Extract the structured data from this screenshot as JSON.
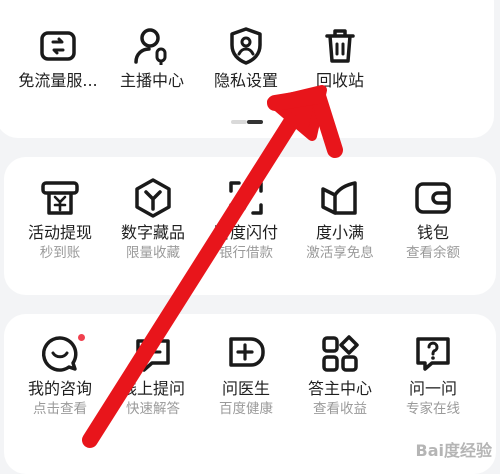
{
  "row1": [
    {
      "label": "免流量服...",
      "icon": "phone-data-icon"
    },
    {
      "label": "主播中心",
      "icon": "anchor-mic-icon"
    },
    {
      "label": "隐私设置",
      "icon": "privacy-shield-icon"
    },
    {
      "label": "回收站",
      "icon": "trash-icon"
    }
  ],
  "row2": [
    {
      "label": "活动提现",
      "sub": "秒到账",
      "icon": "withdraw-icon"
    },
    {
      "label": "数字藏品",
      "sub": "限量收藏",
      "icon": "digital-collection-icon"
    },
    {
      "label": "百度闪付",
      "sub": "银行借款",
      "icon": "flash-pay-icon"
    },
    {
      "label": "度小满",
      "sub": "激活享免息",
      "icon": "duxiaoman-icon"
    },
    {
      "label": "钱包",
      "sub": "查看余额",
      "icon": "wallet-icon"
    }
  ],
  "row3": [
    {
      "label": "我的咨询",
      "sub": "点击查看",
      "icon": "consult-chat-icon",
      "badge": true
    },
    {
      "label": "线上提问",
      "sub": "快速解答",
      "icon": "ask-question-icon"
    },
    {
      "label": "问医生",
      "sub": "百度健康",
      "icon": "doctor-cross-icon"
    },
    {
      "label": "答主中心",
      "sub": "查看收益",
      "icon": "answerer-grid-icon"
    },
    {
      "label": "问一问",
      "sub": "专家在线",
      "icon": "ask-one-icon"
    }
  ],
  "colors": {
    "arrow": "#e8151b",
    "badge": "#f0404e",
    "icon": "#1a1a1a"
  },
  "watermark": "Bai度经验"
}
